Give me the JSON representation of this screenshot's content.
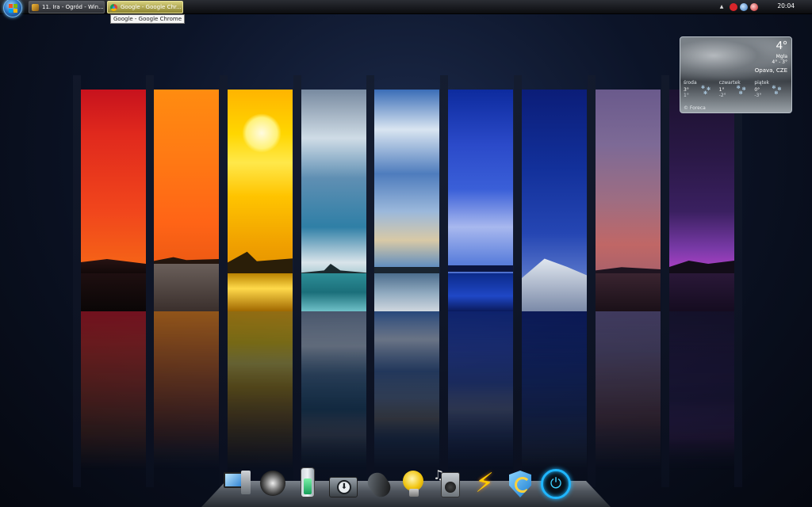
{
  "taskbar": {
    "windows": [
      {
        "label": "11. Ira - Ogród - Win...",
        "icon": "winamp-icon",
        "active": false
      },
      {
        "label": "Google - Google Chr...",
        "icon": "chrome-icon",
        "active": true
      }
    ],
    "tooltip": "Google - Google Chrome",
    "tray": {
      "overflow_arrow": "▲",
      "icons": [
        "antivirus-icon",
        "network-icon",
        "power-manager-icon"
      ]
    },
    "clock": "20:04"
  },
  "weather": {
    "temperature": "4°",
    "condition": "Mgła",
    "range": "4° - 3°",
    "city": "Opava, CZE",
    "forecast": [
      {
        "day": "środa",
        "high": "3°",
        "low": "1°",
        "icon": "snow-icon"
      },
      {
        "day": "czwartek",
        "high": "1°",
        "low": "-2°",
        "icon": "snow-icon"
      },
      {
        "day": "piątek",
        "high": "0°",
        "low": "-3°",
        "icon": "snow-icon"
      }
    ],
    "credit": "© Foreca"
  },
  "dock": {
    "items": [
      "computer-icon",
      "steam-icon",
      "battery-icon",
      "download-icon",
      "mouse-icon",
      "lightbulb-icon",
      "speaker-icon",
      "lightning-icon",
      "security-shield-icon",
      "power-icon"
    ]
  },
  "colors": {
    "desktop_bg": "#0c1428",
    "active_task": "#d6cf7c",
    "power_glow": "#1fb6ff"
  }
}
